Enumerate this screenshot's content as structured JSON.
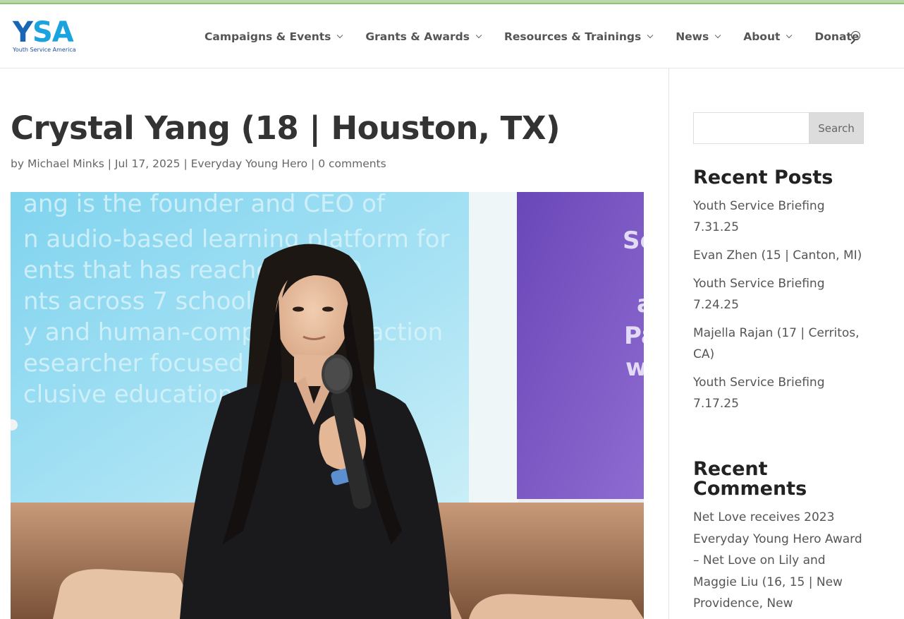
{
  "brand": {
    "logo_text_1": "Y",
    "logo_text_2": "SA",
    "tagline": "Youth Service America",
    "colors": {
      "logo_light": "#1aa3df",
      "logo_dark": "#1866b4",
      "top_strip": "#b9d9a9"
    }
  },
  "nav": {
    "items": [
      {
        "label": "Campaigns & Events",
        "has_dropdown": true
      },
      {
        "label": "Grants & Awards",
        "has_dropdown": true
      },
      {
        "label": "Resources & Trainings",
        "has_dropdown": true
      },
      {
        "label": "News",
        "has_dropdown": true
      },
      {
        "label": "About",
        "has_dropdown": true
      },
      {
        "label": "Donate",
        "has_dropdown": false
      }
    ],
    "search_icon": "search-icon"
  },
  "post": {
    "title": "Crystal Yang (18 | Houston, TX)",
    "meta": {
      "by": "by",
      "author": "Michael Minks",
      "sep": " | ",
      "date": "Jul 17, 2025",
      "category": "Everyday Young Hero",
      "comments": "0 comments"
    },
    "hero_slide_text": [
      "ang is the founder and CEO of",
      "n audio-based learning platform for",
      "ents that has reached 1,000",
      "nts across 7 schools",
      "y and human-computer interaction",
      "esearcher focused on",
      "clusive education"
    ],
    "hero_side_slide_text": [
      "Sc",
      "a",
      "Pa",
      "w"
    ]
  },
  "sidebar": {
    "search": {
      "placeholder": "",
      "button_label": "Search"
    },
    "recent_posts": {
      "title": "Recent Posts",
      "items": [
        "Youth Service Briefing 7.31.25",
        "Evan Zhen (15 | Canton, MI)",
        "Youth Service Briefing 7.24.25",
        "Majella Rajan (17 | Cerritos, CA)",
        "Youth Service Briefing 7.17.25"
      ]
    },
    "recent_comments": {
      "title": "Recent Comments",
      "text": "Net Love receives 2023 Everyday Young Hero Award – Net Love on Lily and Maggie Liu (16, 15 | New Providence, New"
    }
  }
}
